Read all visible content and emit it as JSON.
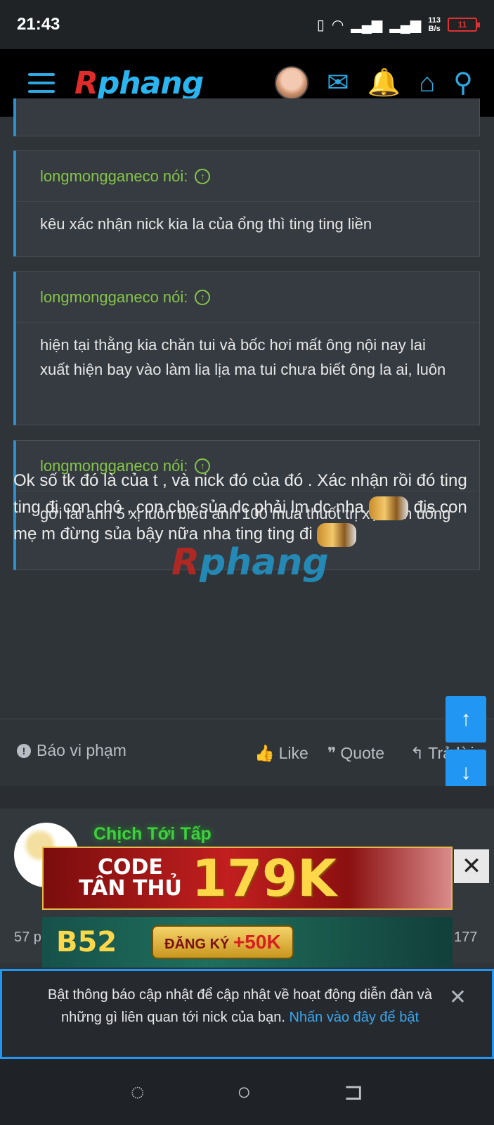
{
  "status_bar": {
    "time": "21:43",
    "net_speed_value": "113",
    "net_speed_unit": "B/s",
    "battery": "11"
  },
  "header": {
    "logo_first": "R",
    "logo_rest": "phang"
  },
  "quotes": [
    {
      "author": "longmongganeco nói:",
      "text": "kêu xác nhận nick kia la của ổng thì ting ting liền"
    },
    {
      "author": "longmongganeco nói:",
      "text": "hiện tại thằng kia chăn tui và bốc hơi mất ông nội nay lai xuất hiện bay vào làm lia lịa ma tui chưa biết ông la ai, luôn"
    },
    {
      "author": "longmongganeco nói:",
      "text": "gởi lai anh 5 xị luôn biếu anh 100 mua thuốt trị xạo lồn uống"
    }
  ],
  "post": {
    "line1": "Ok số tk đó là của t , và nick đó của đó . Xác nhận rồi đó ting ting đi con chó , con cho sủa dc phải lm dc nha",
    "line2": "đis con mẹ m đừng sủa bậy nữa nha ting ting đi"
  },
  "actions": {
    "report": "Báo vi phạm",
    "like": "Like",
    "quote": "Quote",
    "reply": "Trả lời"
  },
  "next_post": {
    "username": "Chịch Tới Tấp",
    "left_stat": "57 p",
    "right_stat": "177"
  },
  "ads": {
    "ad1_line1": "CODE",
    "ad1_line2": "TÂN THỦ",
    "ad1_amount": "179K",
    "ad2_brand": "B52",
    "ad2_cta": "ĐĂNG KÝ",
    "ad2_bonus": "+50K"
  },
  "notification": {
    "text": "Bật thông báo cập nhật để cập nhật về hoạt động diễn đàn và những gì liên quan tới nick của bạn.",
    "link": "Nhấn vào đây để bật"
  },
  "watermark": {
    "first": "R",
    "rest": "phang"
  },
  "colors": {
    "accent": "#2196f3",
    "quote_author": "#84c548",
    "username": "#3ecf3e",
    "background": "#2f3439"
  }
}
